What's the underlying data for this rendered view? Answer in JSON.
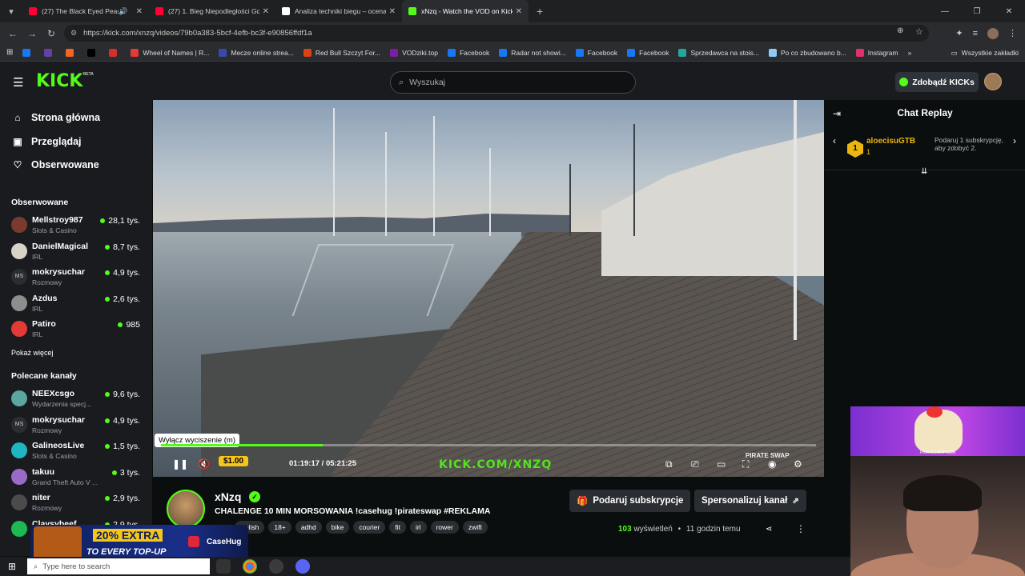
{
  "browser": {
    "tabs": [
      {
        "title": "(27) The Black Eyed Peas - I",
        "fav": "#ff0033",
        "audio": true
      },
      {
        "title": "(27) 1. Bieg Niepodległości Gdy",
        "fav": "#ff0033",
        "audio": false
      },
      {
        "title": "Analiza techniki biegu – ocena",
        "fav": "#ffffff",
        "audio": false
      },
      {
        "title": "xNzq - Watch the VOD on Kick",
        "fav": "#53fc18",
        "audio": false,
        "active": true
      }
    ],
    "url": "https://kick.com/xnzq/videos/79b0a383-5bcf-4efb-bc3f-e90856ffdf1a",
    "bookmarks": [
      {
        "label": "",
        "color": "#1877f2"
      },
      {
        "label": "",
        "color": "#6441a5"
      },
      {
        "label": "",
        "color": "#f26522"
      },
      {
        "label": "",
        "color": "#000000"
      },
      {
        "label": "",
        "color": "#d32f2f"
      },
      {
        "label": "Wheel of Names | R...",
        "color": "#e53935"
      },
      {
        "label": "Mecze online strea...",
        "color": "#3949ab"
      },
      {
        "label": "Red Bull Szczyt For...",
        "color": "#d84315"
      },
      {
        "label": "VODziki.top",
        "color": "#7b1fa2"
      },
      {
        "label": "Facebook",
        "color": "#1877f2"
      },
      {
        "label": "Radar not showi...",
        "color": "#1877f2"
      },
      {
        "label": "Facebook",
        "color": "#1877f2"
      },
      {
        "label": "Facebook",
        "color": "#1877f2"
      },
      {
        "label": "Sprzedawca na stois...",
        "color": "#26a69a"
      },
      {
        "label": "Po co zbudowano b...",
        "color": "#90caf9"
      },
      {
        "label": "Instagram",
        "color": "#e1306c"
      }
    ],
    "bookmarks_all": "Wszystkie zakładki"
  },
  "kick": {
    "logo": "KICK",
    "beta": "BETA",
    "search_placeholder": "Wyszukaj",
    "kicks_button": "Zdobądź KICKs"
  },
  "sidebar": {
    "nav": [
      {
        "label": "Strona główna",
        "icon": "⌂"
      },
      {
        "label": "Przeglądaj",
        "icon": "▣"
      },
      {
        "label": "Obserwowane",
        "icon": "♡"
      }
    ],
    "followed_title": "Obserwowane",
    "followed": [
      {
        "name": "Mellstroy987",
        "category": "Slots & Casino",
        "viewers": "28,1 tys.",
        "color": "#7a3b2e"
      },
      {
        "name": "DanielMagical",
        "category": "IRL",
        "viewers": "8,7 tys.",
        "color": "#d8d2c8"
      },
      {
        "name": "mokrysuchar",
        "category": "Rozmowy",
        "viewers": "4,9 tys.",
        "color": "#2a2d31",
        "initials": "MS"
      },
      {
        "name": "Azdus",
        "category": "IRL",
        "viewers": "2,6 tys.",
        "color": "#8d8d8d"
      },
      {
        "name": "Patiro",
        "category": "IRL",
        "viewers": "985",
        "color": "#e53935"
      }
    ],
    "show_more": "Pokaż więcej",
    "recommended_title": "Polecane kanały",
    "recommended": [
      {
        "name": "NEEXcsgo",
        "category": "Wydarzenia specj...",
        "viewers": "9,6 tys.",
        "color": "#5aa7a0"
      },
      {
        "name": "mokrysuchar",
        "category": "Rozmowy",
        "viewers": "4,9 tys.",
        "color": "#2a2d31",
        "initials": "MS"
      },
      {
        "name": "GalineosLive",
        "category": "Slots & Casino",
        "viewers": "1,5 tys.",
        "color": "#1fb6c1"
      },
      {
        "name": "takuu",
        "category": "Grand Theft Auto V ...",
        "viewers": "3 tys.",
        "color": "#9a6bc6"
      },
      {
        "name": "niter",
        "category": "Rozmowy",
        "viewers": "2,9 tys.",
        "color": "#4b4b4b"
      },
      {
        "name": "Claysybeef",
        "category": "",
        "viewers": "2,9 tys.",
        "color": "#1db954"
      }
    ]
  },
  "player": {
    "tooltip": "Wyłącz wyciszenie (m)",
    "current_time": "01:19:17",
    "separator": "/",
    "duration": "05:21:25",
    "progress": 0.247,
    "overlay_url": "KICK.COM/XNZQ",
    "donation": "$1.00",
    "pirate_logo": "PIRATE SWAP"
  },
  "stream": {
    "streamer": "xNzq",
    "title": "CHALENGE 10 MIN MORSOWANIA !casehug !pirateswap #REKLAMA",
    "category": "IRL",
    "tags": [
      "Polish",
      "18+",
      "adhd",
      "bike",
      "courier",
      "fit",
      "irl",
      "rower",
      "zwift"
    ],
    "subscribe_button": "Podaruj subskrypcje",
    "customize_button": "Spersonalizuj kanał",
    "views_count": "103",
    "views_label": "wyświetleń",
    "dot": "•",
    "time_ago": "11 godzin temu"
  },
  "chat": {
    "title": "Chat Replay",
    "gifter": "aloecisuGTB",
    "gifter_count": "1",
    "gift_badge": "1",
    "gift_text": "Podaruj 1 subskrypcję, aby zdobyć 2."
  },
  "webcam": {
    "sponsor": "PIRATESWAP.COM"
  },
  "ad": {
    "line1": "20% EXTRA",
    "line2": "TO EVERY TOP-UP",
    "brand": "CaseHug"
  },
  "taskbar": {
    "search_placeholder": "Type here to search"
  }
}
